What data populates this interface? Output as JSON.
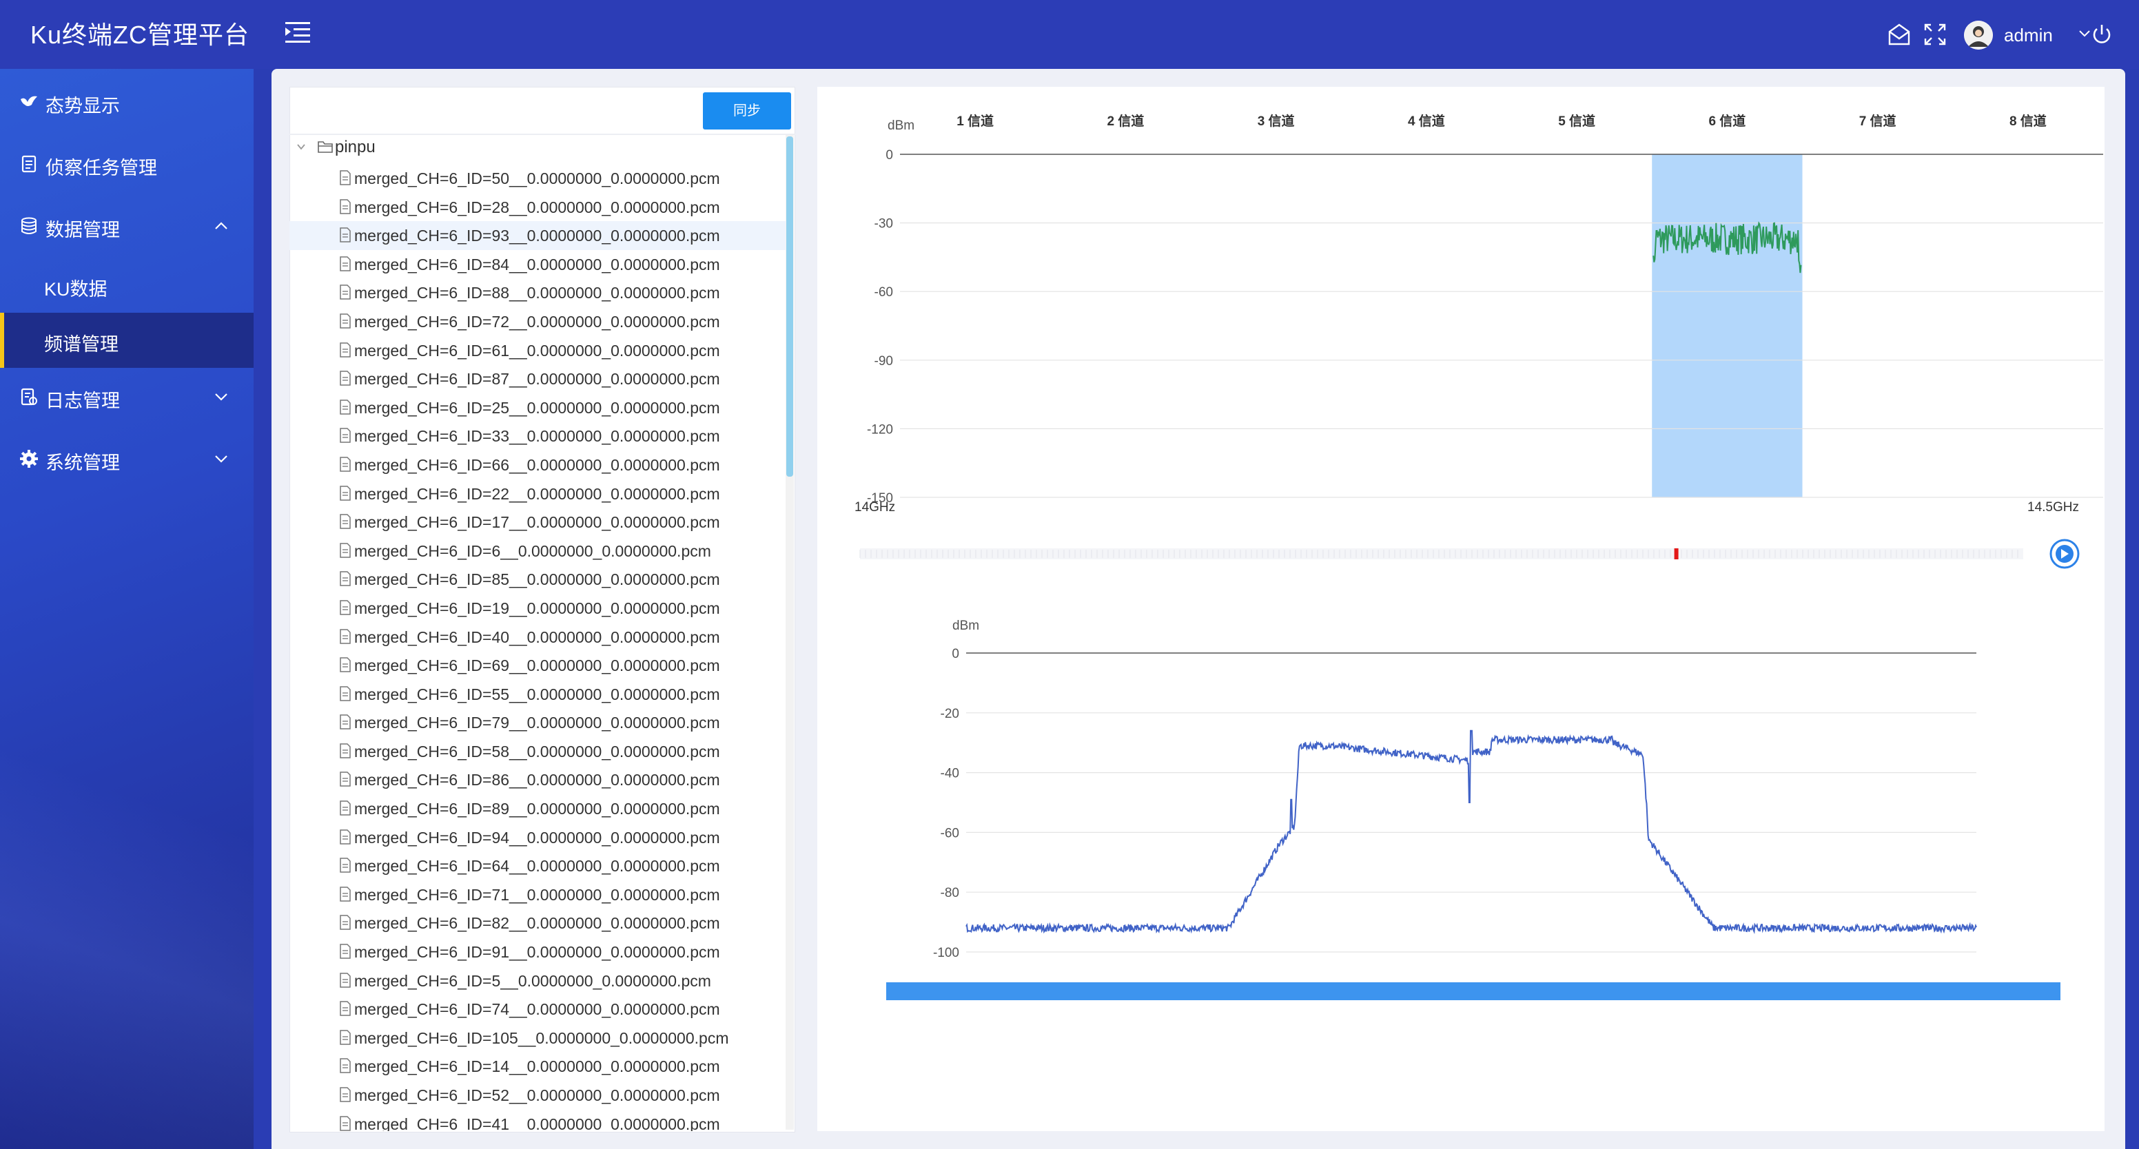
{
  "header": {
    "title": "Ku终端ZC管理平台",
    "username": "admin"
  },
  "sidebar": {
    "items": [
      {
        "label": "态势显示",
        "icon": "bird-icon"
      },
      {
        "label": "侦察任务管理",
        "icon": "document-icon"
      },
      {
        "label": "数据管理",
        "icon": "database-icon",
        "expanded": true
      },
      {
        "label": "日志管理",
        "icon": "log-icon"
      },
      {
        "label": "系统管理",
        "icon": "gear-icon"
      }
    ],
    "sub_items": [
      {
        "label": "KU数据"
      },
      {
        "label": "频谱管理",
        "active": true
      }
    ]
  },
  "file_panel": {
    "sync_label": "同步",
    "root_folder": "pinpu",
    "files": [
      "merged_CH=6_ID=50__0.0000000_0.0000000.pcm",
      "merged_CH=6_ID=28__0.0000000_0.0000000.pcm",
      "merged_CH=6_ID=93__0.0000000_0.0000000.pcm",
      "merged_CH=6_ID=84__0.0000000_0.0000000.pcm",
      "merged_CH=6_ID=88__0.0000000_0.0000000.pcm",
      "merged_CH=6_ID=72__0.0000000_0.0000000.pcm",
      "merged_CH=6_ID=61__0.0000000_0.0000000.pcm",
      "merged_CH=6_ID=87__0.0000000_0.0000000.pcm",
      "merged_CH=6_ID=25__0.0000000_0.0000000.pcm",
      "merged_CH=6_ID=33__0.0000000_0.0000000.pcm",
      "merged_CH=6_ID=66__0.0000000_0.0000000.pcm",
      "merged_CH=6_ID=22__0.0000000_0.0000000.pcm",
      "merged_CH=6_ID=17__0.0000000_0.0000000.pcm",
      "merged_CH=6_ID=6__0.0000000_0.0000000.pcm",
      "merged_CH=6_ID=85__0.0000000_0.0000000.pcm",
      "merged_CH=6_ID=19__0.0000000_0.0000000.pcm",
      "merged_CH=6_ID=40__0.0000000_0.0000000.pcm",
      "merged_CH=6_ID=69__0.0000000_0.0000000.pcm",
      "merged_CH=6_ID=55__0.0000000_0.0000000.pcm",
      "merged_CH=6_ID=79__0.0000000_0.0000000.pcm",
      "merged_CH=6_ID=58__0.0000000_0.0000000.pcm",
      "merged_CH=6_ID=86__0.0000000_0.0000000.pcm",
      "merged_CH=6_ID=89__0.0000000_0.0000000.pcm",
      "merged_CH=6_ID=94__0.0000000_0.0000000.pcm",
      "merged_CH=6_ID=64__0.0000000_0.0000000.pcm",
      "merged_CH=6_ID=71__0.0000000_0.0000000.pcm",
      "merged_CH=6_ID=82__0.0000000_0.0000000.pcm",
      "merged_CH=6_ID=91__0.0000000_0.0000000.pcm",
      "merged_CH=6_ID=5__0.0000000_0.0000000.pcm",
      "merged_CH=6_ID=74__0.0000000_0.0000000.pcm",
      "merged_CH=6_ID=105__0.0000000_0.0000000.pcm",
      "merged_CH=6_ID=14__0.0000000_0.0000000.pcm",
      "merged_CH=6_ID=52__0.0000000_0.0000000.pcm",
      "merged_CH=6_ID=41__0.0000000_0.0000000.pcm"
    ],
    "highlighted_index": 2
  },
  "chart_data": [
    {
      "type": "line",
      "ylabel": "dBm",
      "ylim": [
        -150,
        0
      ],
      "yticks": [
        0,
        -30,
        -60,
        -90,
        -120,
        -150
      ],
      "x_start_label": "14GHz",
      "x_end_label": "14.5GHz",
      "channels": [
        "1 信道",
        "2 信道",
        "3 信道",
        "4 信道",
        "5 信道",
        "6 信道",
        "7 信道",
        "8 信道"
      ],
      "selected_channel": 6,
      "series_color": "#2e9a5c",
      "highlight_color": "#b3d7fb",
      "signal_level": -37,
      "grid": true
    },
    {
      "type": "line",
      "ylabel": "dBm",
      "ylim": [
        -100,
        0
      ],
      "yticks": [
        0,
        -20,
        -40,
        -60,
        -80,
        -100
      ],
      "series_color": "#4163c7",
      "noise_floor": -92,
      "plateau_level": -30,
      "grid": true
    }
  ],
  "timeline": {
    "position": 0.7,
    "marker_color": "#e31818",
    "play_icon": "play-icon"
  },
  "progress": {
    "value": 1.0,
    "color": "#3d94ef"
  }
}
